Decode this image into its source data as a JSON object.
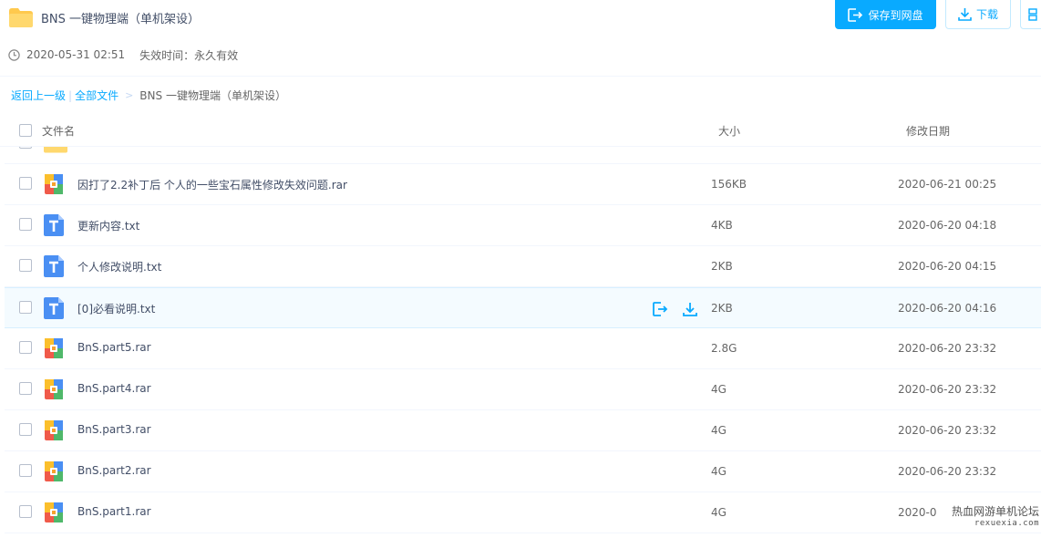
{
  "header": {
    "title": "BNS 一键物理端（单机架设）",
    "save_label": "保存到网盘",
    "download_label": "下载"
  },
  "meta": {
    "created": "2020-05-31 02:51",
    "expire": "失效时间：永久有效"
  },
  "breadcrumb": {
    "back": "返回上一级",
    "all": "全部文件",
    "current": "BNS 一键物理端（单机架设）"
  },
  "table": {
    "col_name": "文件名",
    "col_size": "大小",
    "col_date": "修改日期"
  },
  "files": [
    {
      "name": "因打了2.2补丁后 个人的一些宝石属性修改失效问题.rar",
      "size": "156KB",
      "date": "2020-06-21 00:25",
      "type": "rar"
    },
    {
      "name": "更新内容.txt",
      "size": "4KB",
      "date": "2020-06-20 04:18",
      "type": "txt"
    },
    {
      "name": "个人修改说明.txt",
      "size": "2KB",
      "date": "2020-06-20 04:15",
      "type": "txt"
    },
    {
      "name": "[0]必看说明.txt",
      "size": "2KB",
      "date": "2020-06-20 04:16",
      "type": "txt",
      "hover": true
    },
    {
      "name": "BnS.part5.rar",
      "size": "2.8G",
      "date": "2020-06-20 23:32",
      "type": "rar"
    },
    {
      "name": "BnS.part4.rar",
      "size": "4G",
      "date": "2020-06-20 23:32",
      "type": "rar"
    },
    {
      "name": "BnS.part3.rar",
      "size": "4G",
      "date": "2020-06-20 23:32",
      "type": "rar"
    },
    {
      "name": "BnS.part2.rar",
      "size": "4G",
      "date": "2020-06-20 23:32",
      "type": "rar"
    },
    {
      "name": "BnS.part1.rar",
      "size": "4G",
      "date": "2020-0",
      "type": "rar"
    }
  ],
  "watermark": {
    "line1": "热血网游单机论坛",
    "line2": "rexuexia.com"
  },
  "colors": {
    "accent": "#09aaff",
    "text": "#424e67",
    "folder": "#ffc94d"
  },
  "icons": {
    "folder": "folder-icon",
    "clock": "clock-icon",
    "save": "save-to-disk-icon",
    "download": "download-icon",
    "rar": "rar-archive-icon",
    "txt": "text-file-icon"
  }
}
